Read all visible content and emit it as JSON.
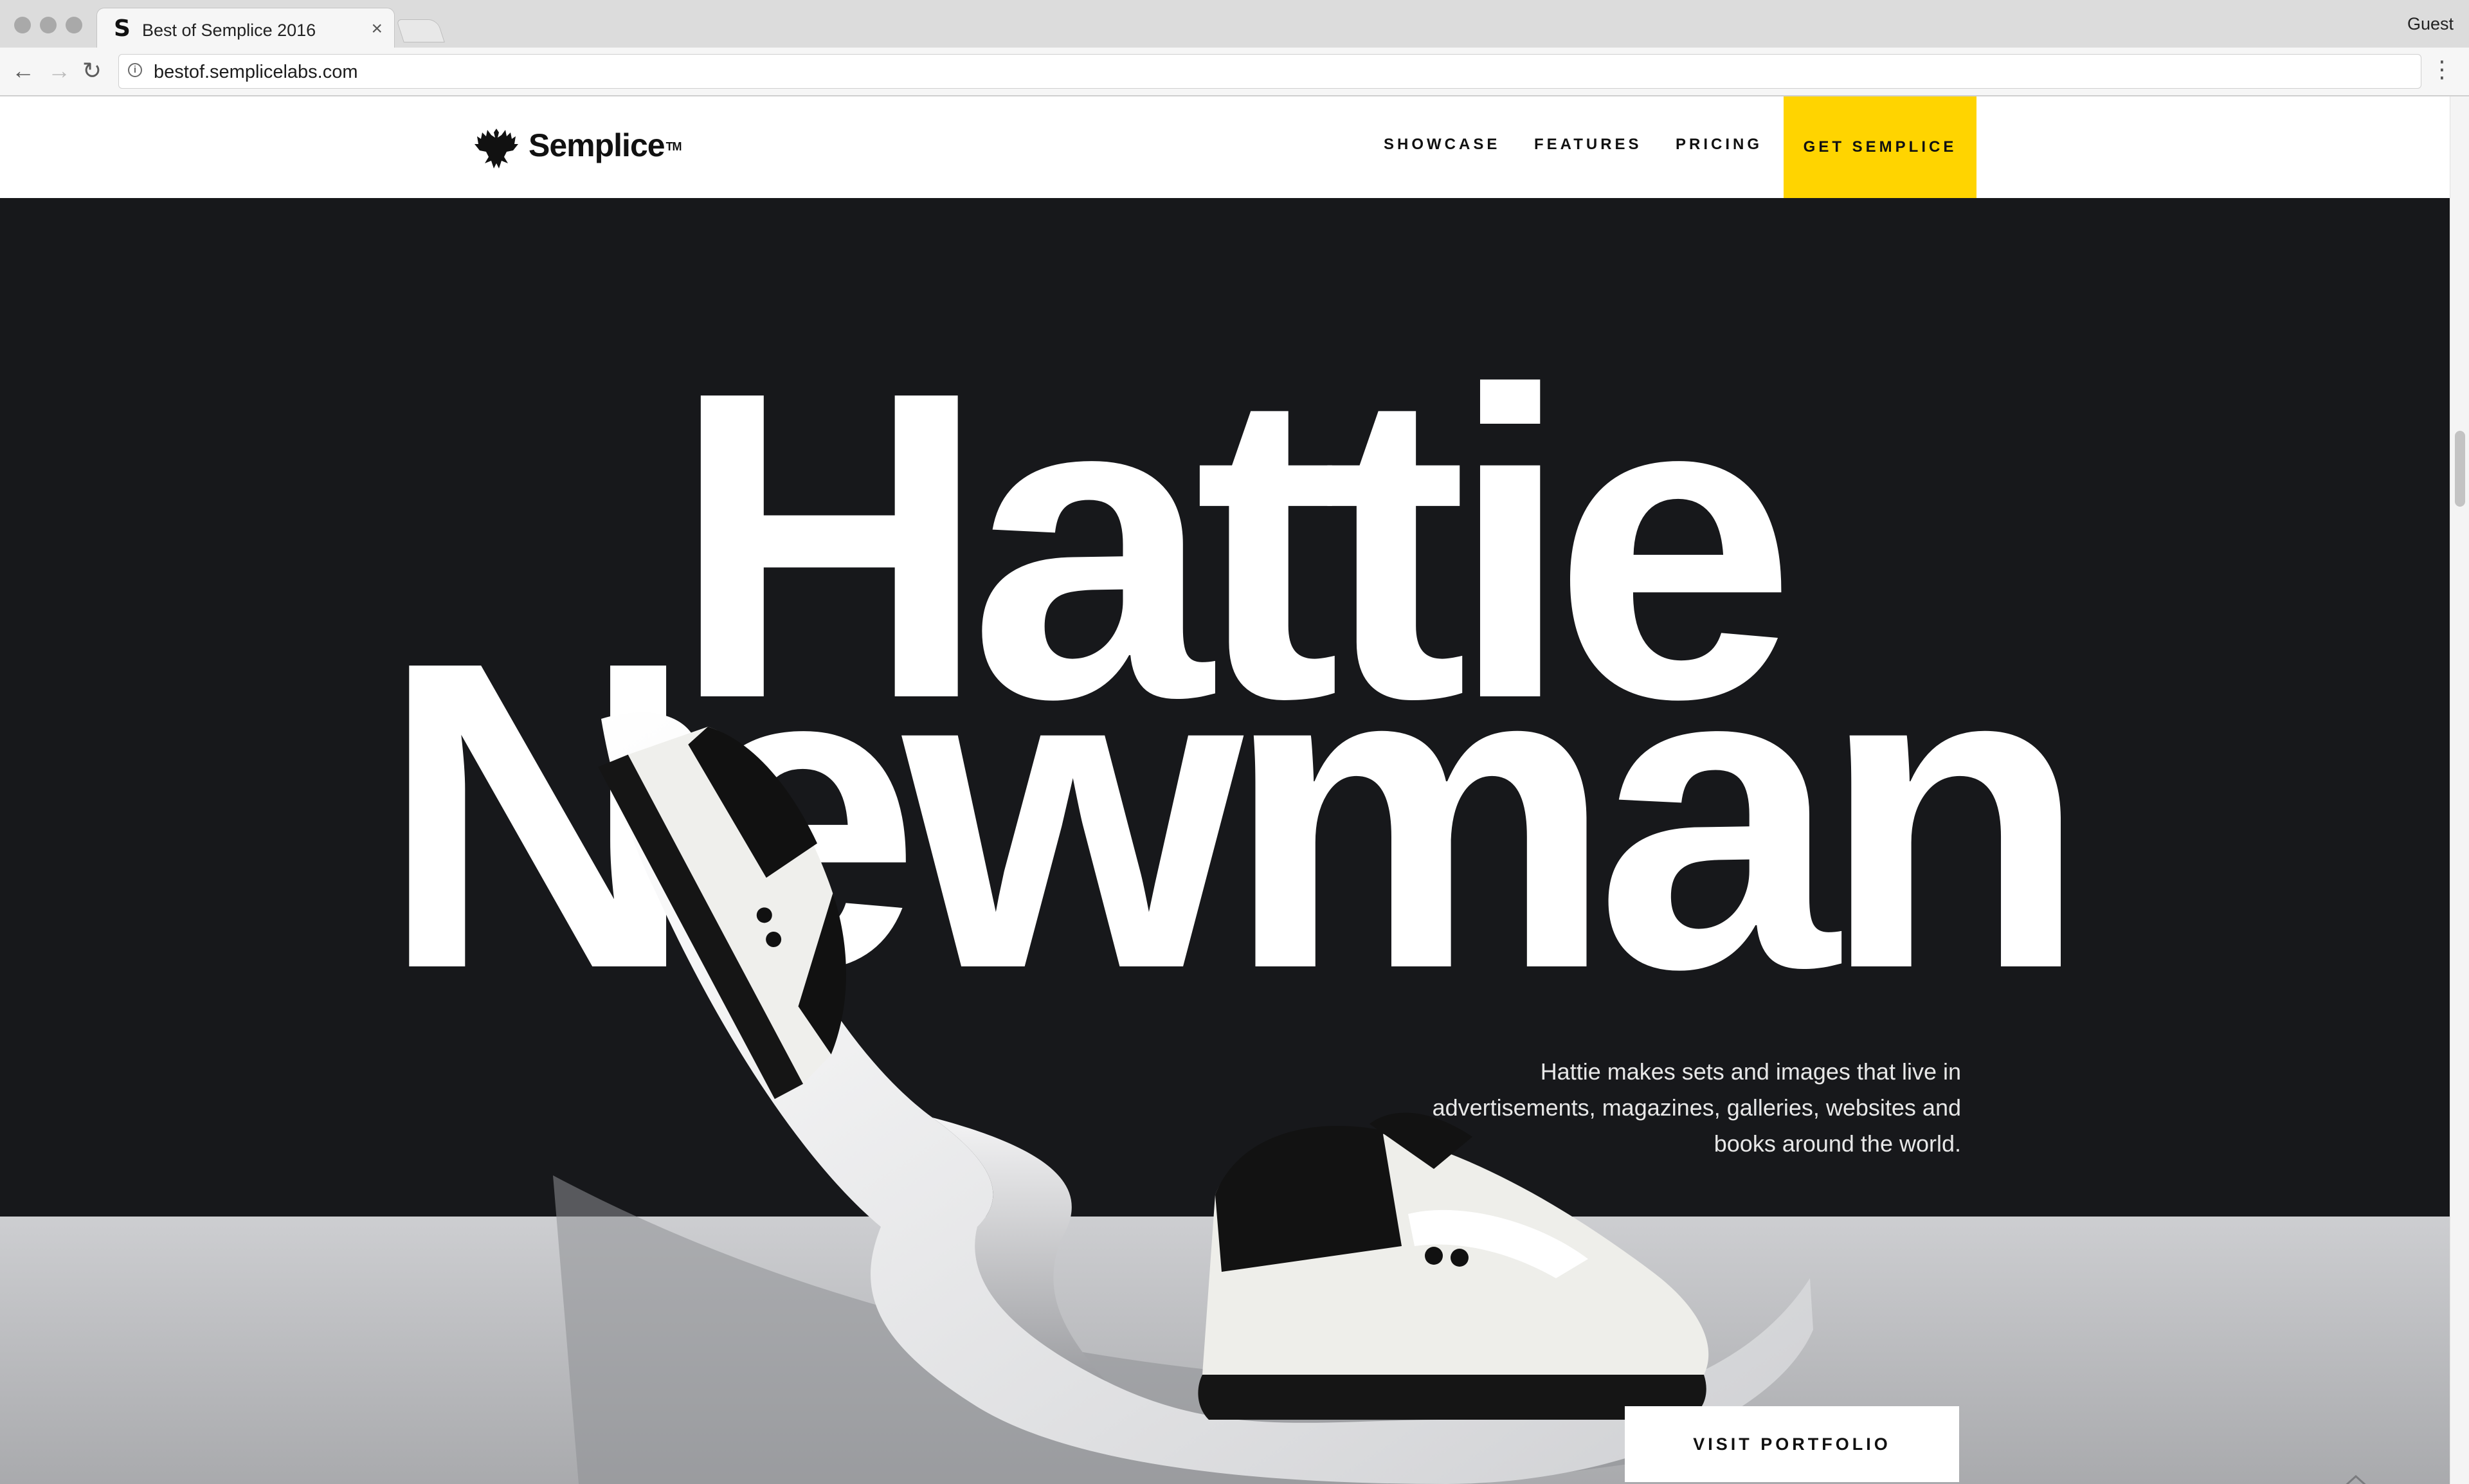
{
  "browser": {
    "tab_title": "Best of Semplice 2016",
    "tab_favicon": "S",
    "tab_close": "×",
    "profile": "Guest",
    "url": "bestof.semplicelabs.com",
    "icons": [
      "back-icon",
      "forward-icon",
      "reload-icon",
      "info-icon",
      "menu-icon"
    ]
  },
  "header": {
    "logo_text": "Semplice",
    "logo_tm": "TM",
    "nav": [
      "SHOWCASE",
      "FEATURES",
      "PRICING"
    ],
    "cta": "GET SEMPLICE"
  },
  "hero": {
    "headline_line1": "Hattie",
    "headline_line2": "Newman",
    "description": "Hattie makes sets and images that live in advertisements, magazines, galleries, websites and books around the world.",
    "button": "VISIT PORTFOLIO"
  },
  "colors": {
    "accent": "#ffd400",
    "hero_background": "#17181b",
    "headline": "#ffffff"
  }
}
